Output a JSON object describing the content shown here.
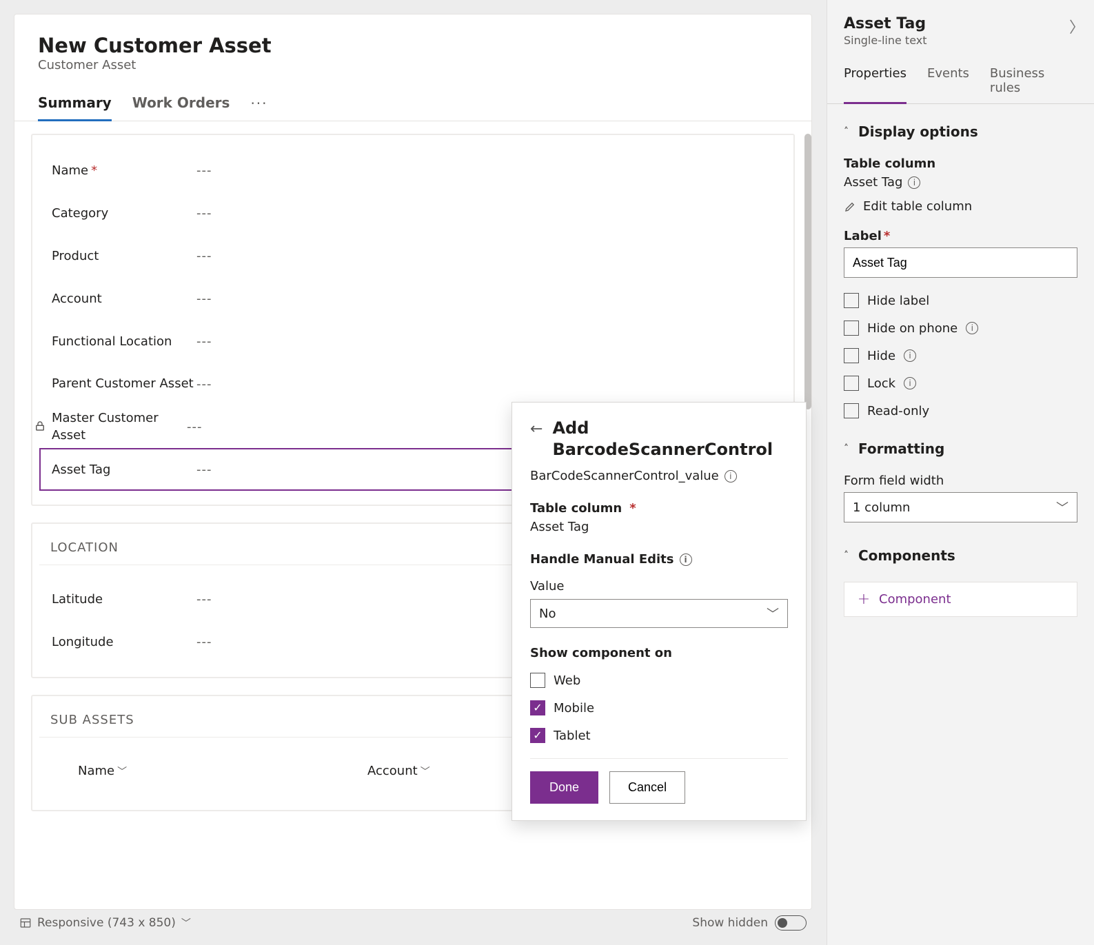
{
  "form": {
    "title": "New Customer Asset",
    "entity": "Customer Asset",
    "tabs": [
      "Summary",
      "Work Orders"
    ],
    "active_tab": "Summary",
    "sections": {
      "main_fields": [
        {
          "label": "Name",
          "required": true,
          "locked": false,
          "value": "---"
        },
        {
          "label": "Category",
          "required": false,
          "locked": false,
          "value": "---"
        },
        {
          "label": "Product",
          "required": false,
          "locked": false,
          "value": "---"
        },
        {
          "label": "Account",
          "required": false,
          "locked": false,
          "value": "---"
        },
        {
          "label": "Functional Location",
          "required": false,
          "locked": false,
          "value": "---"
        },
        {
          "label": "Parent Customer Asset",
          "required": false,
          "locked": false,
          "value": "---"
        },
        {
          "label": "Master Customer Asset",
          "required": false,
          "locked": true,
          "value": "---"
        },
        {
          "label": "Asset Tag",
          "required": false,
          "locked": false,
          "value": "---",
          "selected": true
        }
      ],
      "location": {
        "title": "LOCATION",
        "fields": [
          {
            "label": "Latitude",
            "value": "---"
          },
          {
            "label": "Longitude",
            "value": "---"
          }
        ]
      },
      "sub_assets": {
        "title": "SUB ASSETS",
        "columns": [
          "Name",
          "Account"
        ]
      }
    }
  },
  "footer": {
    "responsive_label": "Responsive (743 x 850)",
    "show_hidden_label": "Show hidden",
    "show_hidden": false
  },
  "properties": {
    "title": "Asset Tag",
    "subtype": "Single-line text",
    "tabs": [
      "Properties",
      "Events",
      "Business rules"
    ],
    "active_tab": "Properties",
    "display_options": {
      "heading": "Display options",
      "table_column_label": "Table column",
      "table_column_value": "Asset Tag",
      "edit_table_column": "Edit table column",
      "label_label": "Label",
      "label_value": "Asset Tag",
      "checks": [
        {
          "text": "Hide label",
          "info": false
        },
        {
          "text": "Hide on phone",
          "info": true
        },
        {
          "text": "Hide",
          "info": true
        },
        {
          "text": "Lock",
          "info": true
        },
        {
          "text": "Read-only",
          "info": false
        }
      ]
    },
    "formatting": {
      "heading": "Formatting",
      "width_label": "Form field width",
      "width_value": "1 column"
    },
    "components": {
      "heading": "Components",
      "add_label": "Component"
    }
  },
  "popover": {
    "title_line1_prefix": "Add",
    "title_line2": "BarcodeScannerControl",
    "subtitle": "BarCodeScannerControl_value",
    "table_column_label": "Table column",
    "table_column_value": "Asset Tag",
    "manual_edits_heading": "Handle Manual Edits",
    "value_label": "Value",
    "value_selected": "No",
    "show_on_heading": "Show component on",
    "targets": [
      {
        "name": "Web",
        "checked": false
      },
      {
        "name": "Mobile",
        "checked": true
      },
      {
        "name": "Tablet",
        "checked": true
      }
    ],
    "done_label": "Done",
    "cancel_label": "Cancel"
  }
}
